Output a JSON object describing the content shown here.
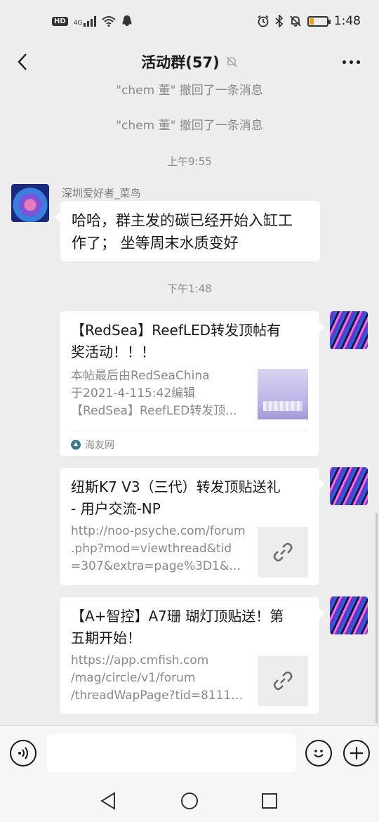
{
  "status_bar": {
    "hd": "HD",
    "network": "4G",
    "time": "1:48",
    "battery_level": 0.25,
    "battery_color": "#f0a020"
  },
  "nav": {
    "title": "活动群(57)",
    "back_icon": "chevron-left-icon",
    "mute_icon": "bell-off-icon",
    "more_icon": "more-dots-icon"
  },
  "messages": {
    "recall_1": "\"chem 董\" 撤回了一条消息",
    "recall_2": "\"chem 董\" 撤回了一条消息",
    "time_1": "上午9:55",
    "sender_1": "深圳爱好者_菜鸟",
    "text_1_line1": "哈哈，群主发的碳已经开始入缸工",
    "text_1_line2": "作了； 坐等周末水质变好",
    "time_2": "下午1:48"
  },
  "cards": [
    {
      "title_line1": "【RedSea】ReefLED转发顶帖有",
      "title_line2": "奖活动！！！",
      "desc_line1": "本帖最后由RedSeaChina",
      "desc_line2": "于2021-4-115:42编辑",
      "desc_line3": "【RedSea】ReefLED转发顶...",
      "source": "海友网",
      "thumb": "reef-tank-image"
    },
    {
      "title_line1": "纽斯K7 V3（三代）转发顶贴送礼",
      "title_line2": "- 用户交流-NP",
      "desc_line1": "http://noo-psyche.com/forum",
      "desc_line2": ".php?mod=viewthread&tid",
      "desc_line3": "=307&extra=page%3D1&mo...",
      "thumb": "link-icon"
    },
    {
      "title_line1": "【A+智控】A7珊 瑚灯顶贴送！第",
      "title_line2": "五期开始！",
      "desc_line1": "https://app.cmfish.com",
      "desc_line2": "/mag/circle/v1/forum",
      "desc_line3": "/threadWapPage?tid=81119...",
      "thumb": "link-icon"
    }
  ],
  "input_bar": {
    "voice_icon": "voice-icon",
    "emoji_icon": "emoji-icon",
    "add_icon": "plus-circle-icon",
    "placeholder": ""
  },
  "system_nav": {
    "back": "triangle-back-icon",
    "home": "circle-home-icon",
    "recent": "square-recent-icon"
  }
}
